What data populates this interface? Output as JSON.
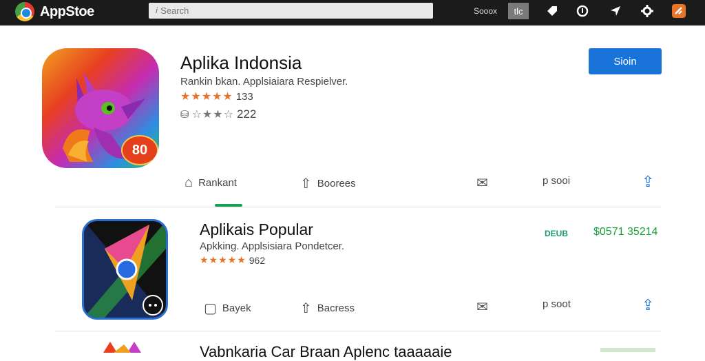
{
  "topbar": {
    "brand": "AppStoe",
    "search_placeholder": "Search",
    "store_label": "Sooox",
    "tile_label": "tlc"
  },
  "featured": {
    "title": "Aplika Indonsia",
    "subtitle": "Rankin  bkan. Applsiaiara Respielver.",
    "rating_count": "133",
    "secondary_count": "222",
    "badge": "80",
    "primary_button": "Sioin",
    "actions": {
      "rankant": "Rankant",
      "boorees": "Boorees",
      "sooi": "p sooi"
    }
  },
  "popular": {
    "title": "Aplikais Popular",
    "subtitle": "Apkking. Applsisiara Pondetcer.",
    "rating_count": "962",
    "dev_label": "DEUB",
    "price": "$0571 35214",
    "actions": {
      "bayek": "Bayek",
      "bacress": "Bacress",
      "sooi": "p soot"
    }
  },
  "third": {
    "title": "Vabnkaria Car Braan Aplenc taaaaaie"
  },
  "colors": {
    "topbar": "#1b1b1b",
    "primary": "#1a73d9",
    "accent_green": "#18a058",
    "star_orange": "#e8742a"
  }
}
